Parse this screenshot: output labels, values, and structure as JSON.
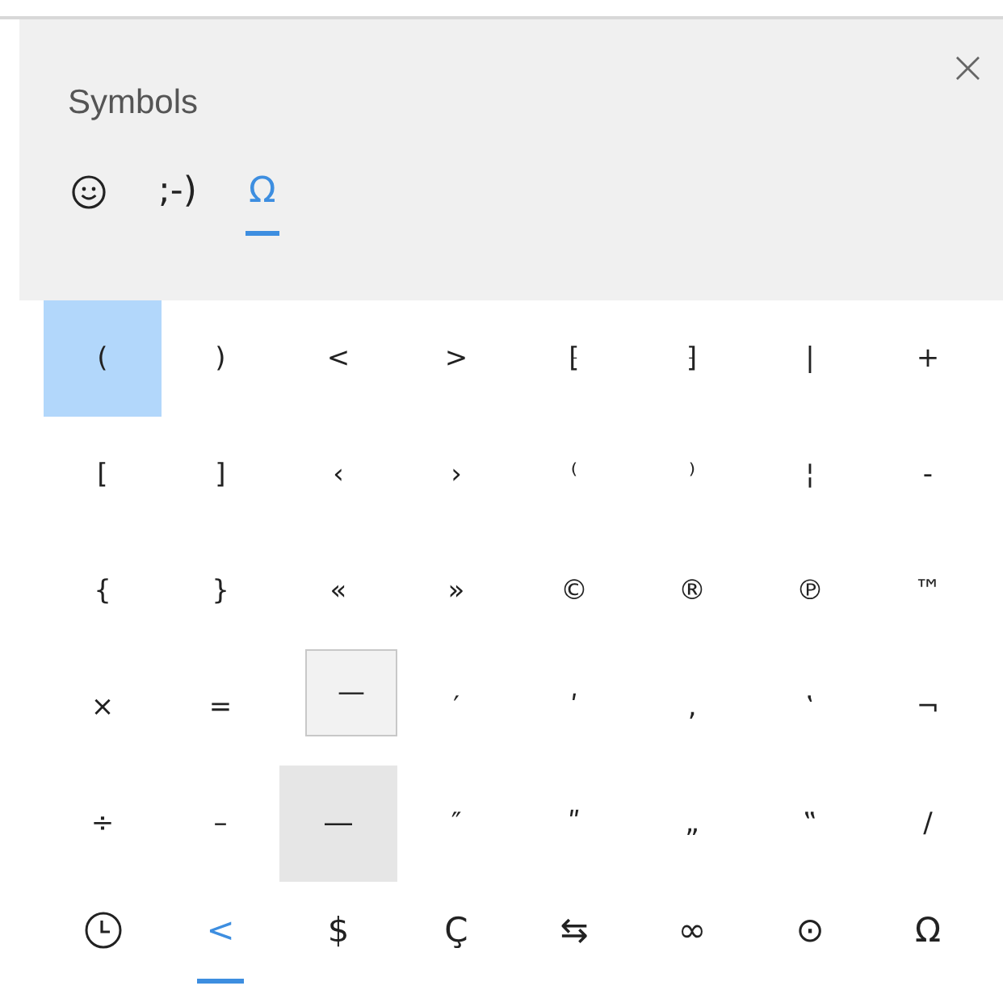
{
  "panel": {
    "title": "Symbols",
    "close": "×"
  },
  "tabs": [
    {
      "kind": "smiley",
      "selected": false
    },
    {
      "kind": "text",
      "label": ";-)",
      "selected": false
    },
    {
      "kind": "text",
      "label": "Ω",
      "selected": true
    }
  ],
  "grid": [
    [
      {
        "char": "(",
        "selected": true
      },
      {
        "char": ")",
        "selected": false
      },
      {
        "char": "<",
        "selected": false
      },
      {
        "char": ">",
        "selected": false
      },
      {
        "char": "⁅",
        "selected": false
      },
      {
        "char": "⁆",
        "selected": false
      },
      {
        "char": "|",
        "selected": false
      },
      {
        "char": "+",
        "selected": false
      }
    ],
    [
      {
        "char": "[",
        "selected": false
      },
      {
        "char": "]",
        "selected": false
      },
      {
        "char": "‹",
        "selected": false
      },
      {
        "char": "›",
        "selected": false
      },
      {
        "char": "⁽",
        "selected": false
      },
      {
        "char": "⁾",
        "selected": false
      },
      {
        "char": "¦",
        "selected": false
      },
      {
        "char": "-",
        "selected": false
      }
    ],
    [
      {
        "char": "{",
        "selected": false
      },
      {
        "char": "}",
        "selected": false
      },
      {
        "char": "«",
        "selected": false
      },
      {
        "char": "»",
        "selected": false
      },
      {
        "char": "©",
        "selected": false
      },
      {
        "char": "®",
        "selected": false
      },
      {
        "char": "℗",
        "selected": false
      },
      {
        "char": "™",
        "selected": false
      }
    ],
    [
      {
        "char": "×",
        "selected": false
      },
      {
        "char": "=",
        "selected": false
      },
      {
        "char": "—",
        "selected": false,
        "hovered": true
      },
      {
        "char": "′",
        "selected": false
      },
      {
        "char": "ʹ",
        "selected": false
      },
      {
        "char": "‚",
        "selected": false
      },
      {
        "char": "‛",
        "selected": false
      },
      {
        "char": "¬",
        "selected": false
      }
    ],
    [
      {
        "char": "÷",
        "selected": false
      },
      {
        "char": "–",
        "selected": false
      },
      {
        "char": "―",
        "selected": false,
        "pressed": true
      },
      {
        "char": "″",
        "selected": false
      },
      {
        "char": "ʺ",
        "selected": false
      },
      {
        "char": "„",
        "selected": false
      },
      {
        "char": "‟",
        "selected": false
      },
      {
        "char": "/",
        "selected": false
      }
    ]
  ],
  "categories": [
    {
      "kind": "recent",
      "selected": false
    },
    {
      "kind": "text",
      "label": "<",
      "selected": true
    },
    {
      "kind": "text",
      "label": "$",
      "selected": false
    },
    {
      "kind": "text",
      "label": "Ç",
      "selected": false
    },
    {
      "kind": "text",
      "label": "⇆",
      "selected": false
    },
    {
      "kind": "text",
      "label": "∞",
      "selected": false
    },
    {
      "kind": "text",
      "label": "⊙",
      "selected": false
    },
    {
      "kind": "text",
      "label": "Ω",
      "selected": false
    }
  ]
}
